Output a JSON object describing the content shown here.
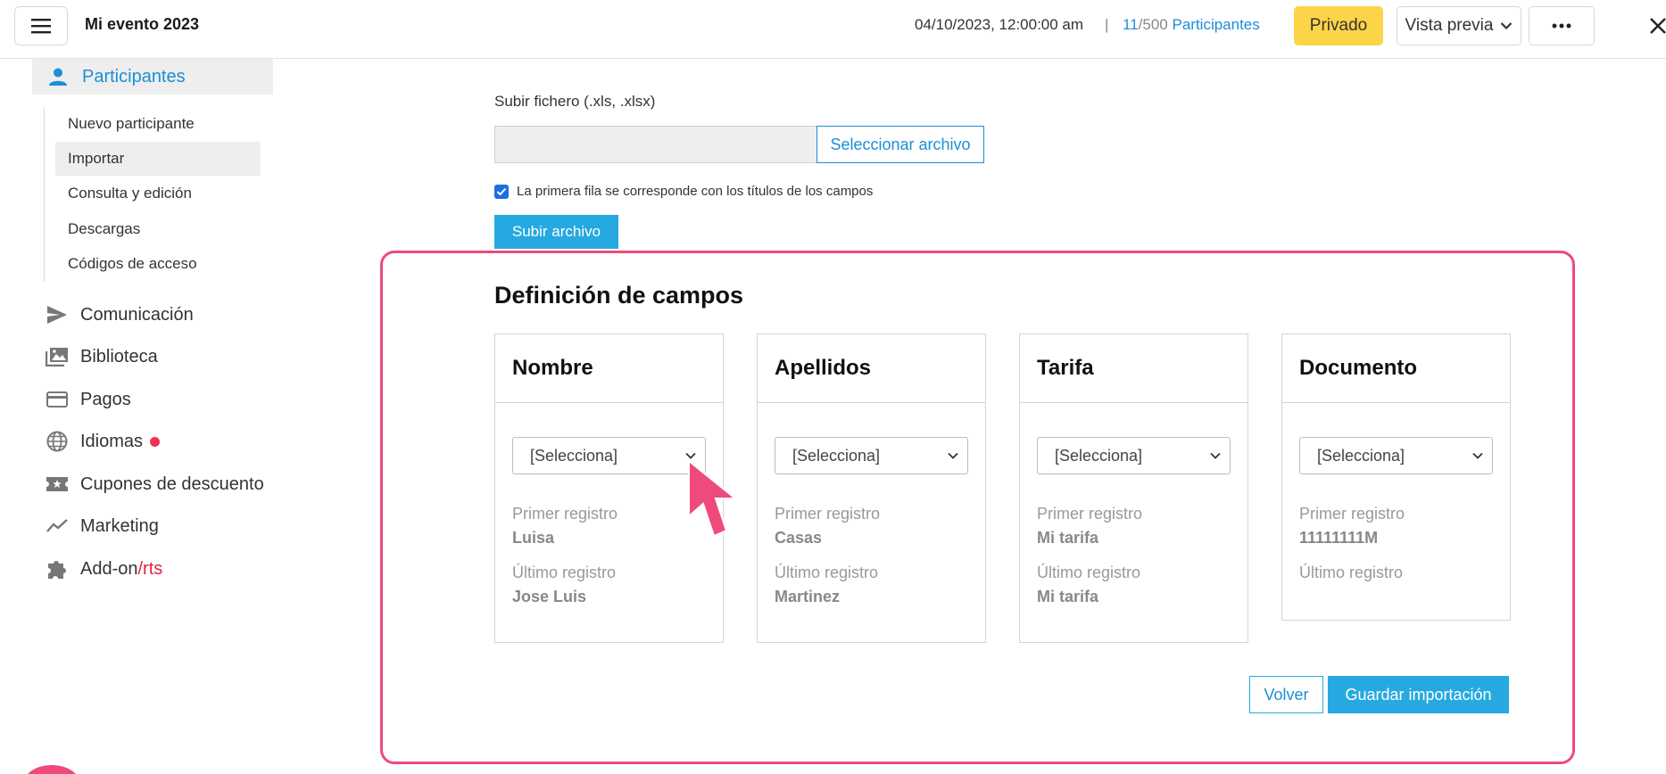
{
  "header": {
    "event_title": "Mi evento 2023",
    "datetime": "04/10/2023, 12:00:00 am",
    "separator": "|",
    "participants_current": "11",
    "participants_total": "/500",
    "participants_label": "Participantes",
    "privacy_label": "Privado",
    "preview_label": "Vista previa",
    "icons": {
      "menu": "hamburger-icon",
      "more": "ellipsis-icon",
      "close": "close-icon",
      "dropdown": "chevron-down-icon"
    }
  },
  "sidebar": {
    "active_section": {
      "label": "Participantes",
      "icon": "user-icon"
    },
    "sub_items": [
      {
        "label": "Nuevo participante"
      },
      {
        "label": "Importar",
        "selected": true
      },
      {
        "label": "Consulta y edición"
      },
      {
        "label": "Descargas"
      },
      {
        "label": "Códigos de acceso"
      }
    ],
    "items": [
      {
        "label": "Comunicación",
        "icon": "send-icon"
      },
      {
        "label": "Biblioteca",
        "icon": "images-icon"
      },
      {
        "label": "Pagos",
        "icon": "credit-card-icon"
      },
      {
        "label": "Idiomas",
        "icon": "globe-icon",
        "badge_color": "#ee3355"
      },
      {
        "label": "Cupones de descuento",
        "icon": "ticket-icon"
      },
      {
        "label": "Marketing",
        "icon": "trend-icon"
      },
      {
        "label": "Add-on",
        "label_suffix": "/rts",
        "icon": "puzzle-icon"
      }
    ]
  },
  "upload": {
    "label": "Subir fichero (.xls, .xlsx)",
    "file_value": "",
    "select_button": "Seleccionar archivo",
    "checkbox_label": "La primera fila se corresponde con los títulos de los campos",
    "checkbox_checked": true,
    "submit_button": "Subir archivo"
  },
  "fields": {
    "title": "Definición de campos",
    "columns": [
      {
        "name": "Nombre",
        "select_value": "[Selecciona]",
        "first_label": "Primer registro",
        "first_value": "Luisa",
        "last_label": "Último registro",
        "last_value": "Jose Luis"
      },
      {
        "name": "Apellidos",
        "select_value": "[Selecciona]",
        "first_label": "Primer registro",
        "first_value": "Casas",
        "last_label": "Último registro",
        "last_value": "Martinez"
      },
      {
        "name": "Tarifa",
        "select_value": "[Selecciona]",
        "first_label": "Primer registro",
        "first_value": "Mi tarifa",
        "last_label": "Último registro",
        "last_value": "Mi tarifa"
      },
      {
        "name": "Documento",
        "select_value": "[Selecciona]",
        "first_label": "Primer registro",
        "first_value": "11111111M",
        "last_label": "Último registro",
        "last_value": ""
      }
    ],
    "back_button": "Volver",
    "save_button": "Guardar importación"
  },
  "colors": {
    "accent": "#26a9e0",
    "link": "#1b8fd6",
    "privado": "#fbd448",
    "highlight": "#ee4a7b"
  }
}
